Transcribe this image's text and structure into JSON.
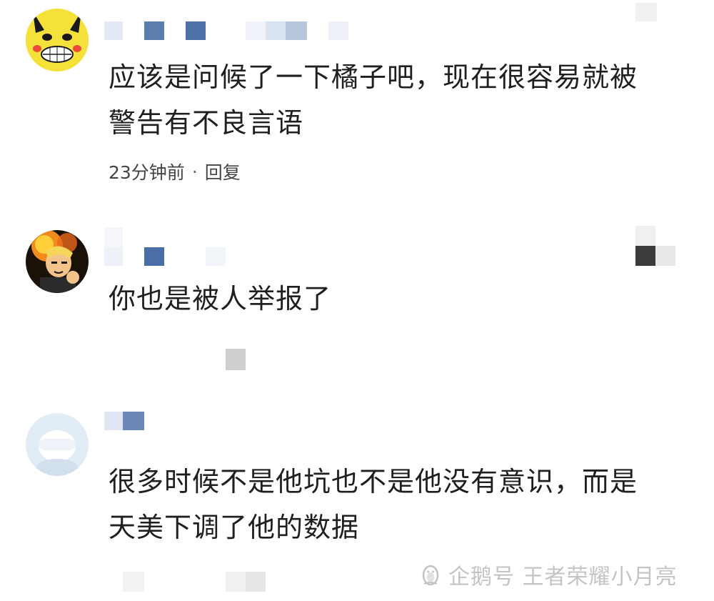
{
  "comments": [
    {
      "text_line1": "应该是问候了一下橘子吧，现在很容易就被",
      "text_line2": "警告有不良言语",
      "time": "23分钟前",
      "separator": "·",
      "reply_label": "回复",
      "avatar_icon": "pikachu-meme-avatar-icon"
    },
    {
      "text_line1": "你也是被人举报了",
      "avatar_icon": "anime-character-avatar-icon"
    },
    {
      "text_line1": "很多时候不是他坑也不是他没有意识，而是",
      "text_line2": "天美下调了他的数据",
      "avatar_icon": "default-avatar-icon"
    }
  ],
  "watermark": {
    "text": "企鹅号 王者荣耀小月亮",
    "icon": "penguin-logo-icon"
  },
  "colors": {
    "censor_blue": "#5a7fb5",
    "censor_light": "#dbe4f1",
    "censor_gray": "#cfcfcf",
    "censor_dark": "#3a3a3a"
  }
}
